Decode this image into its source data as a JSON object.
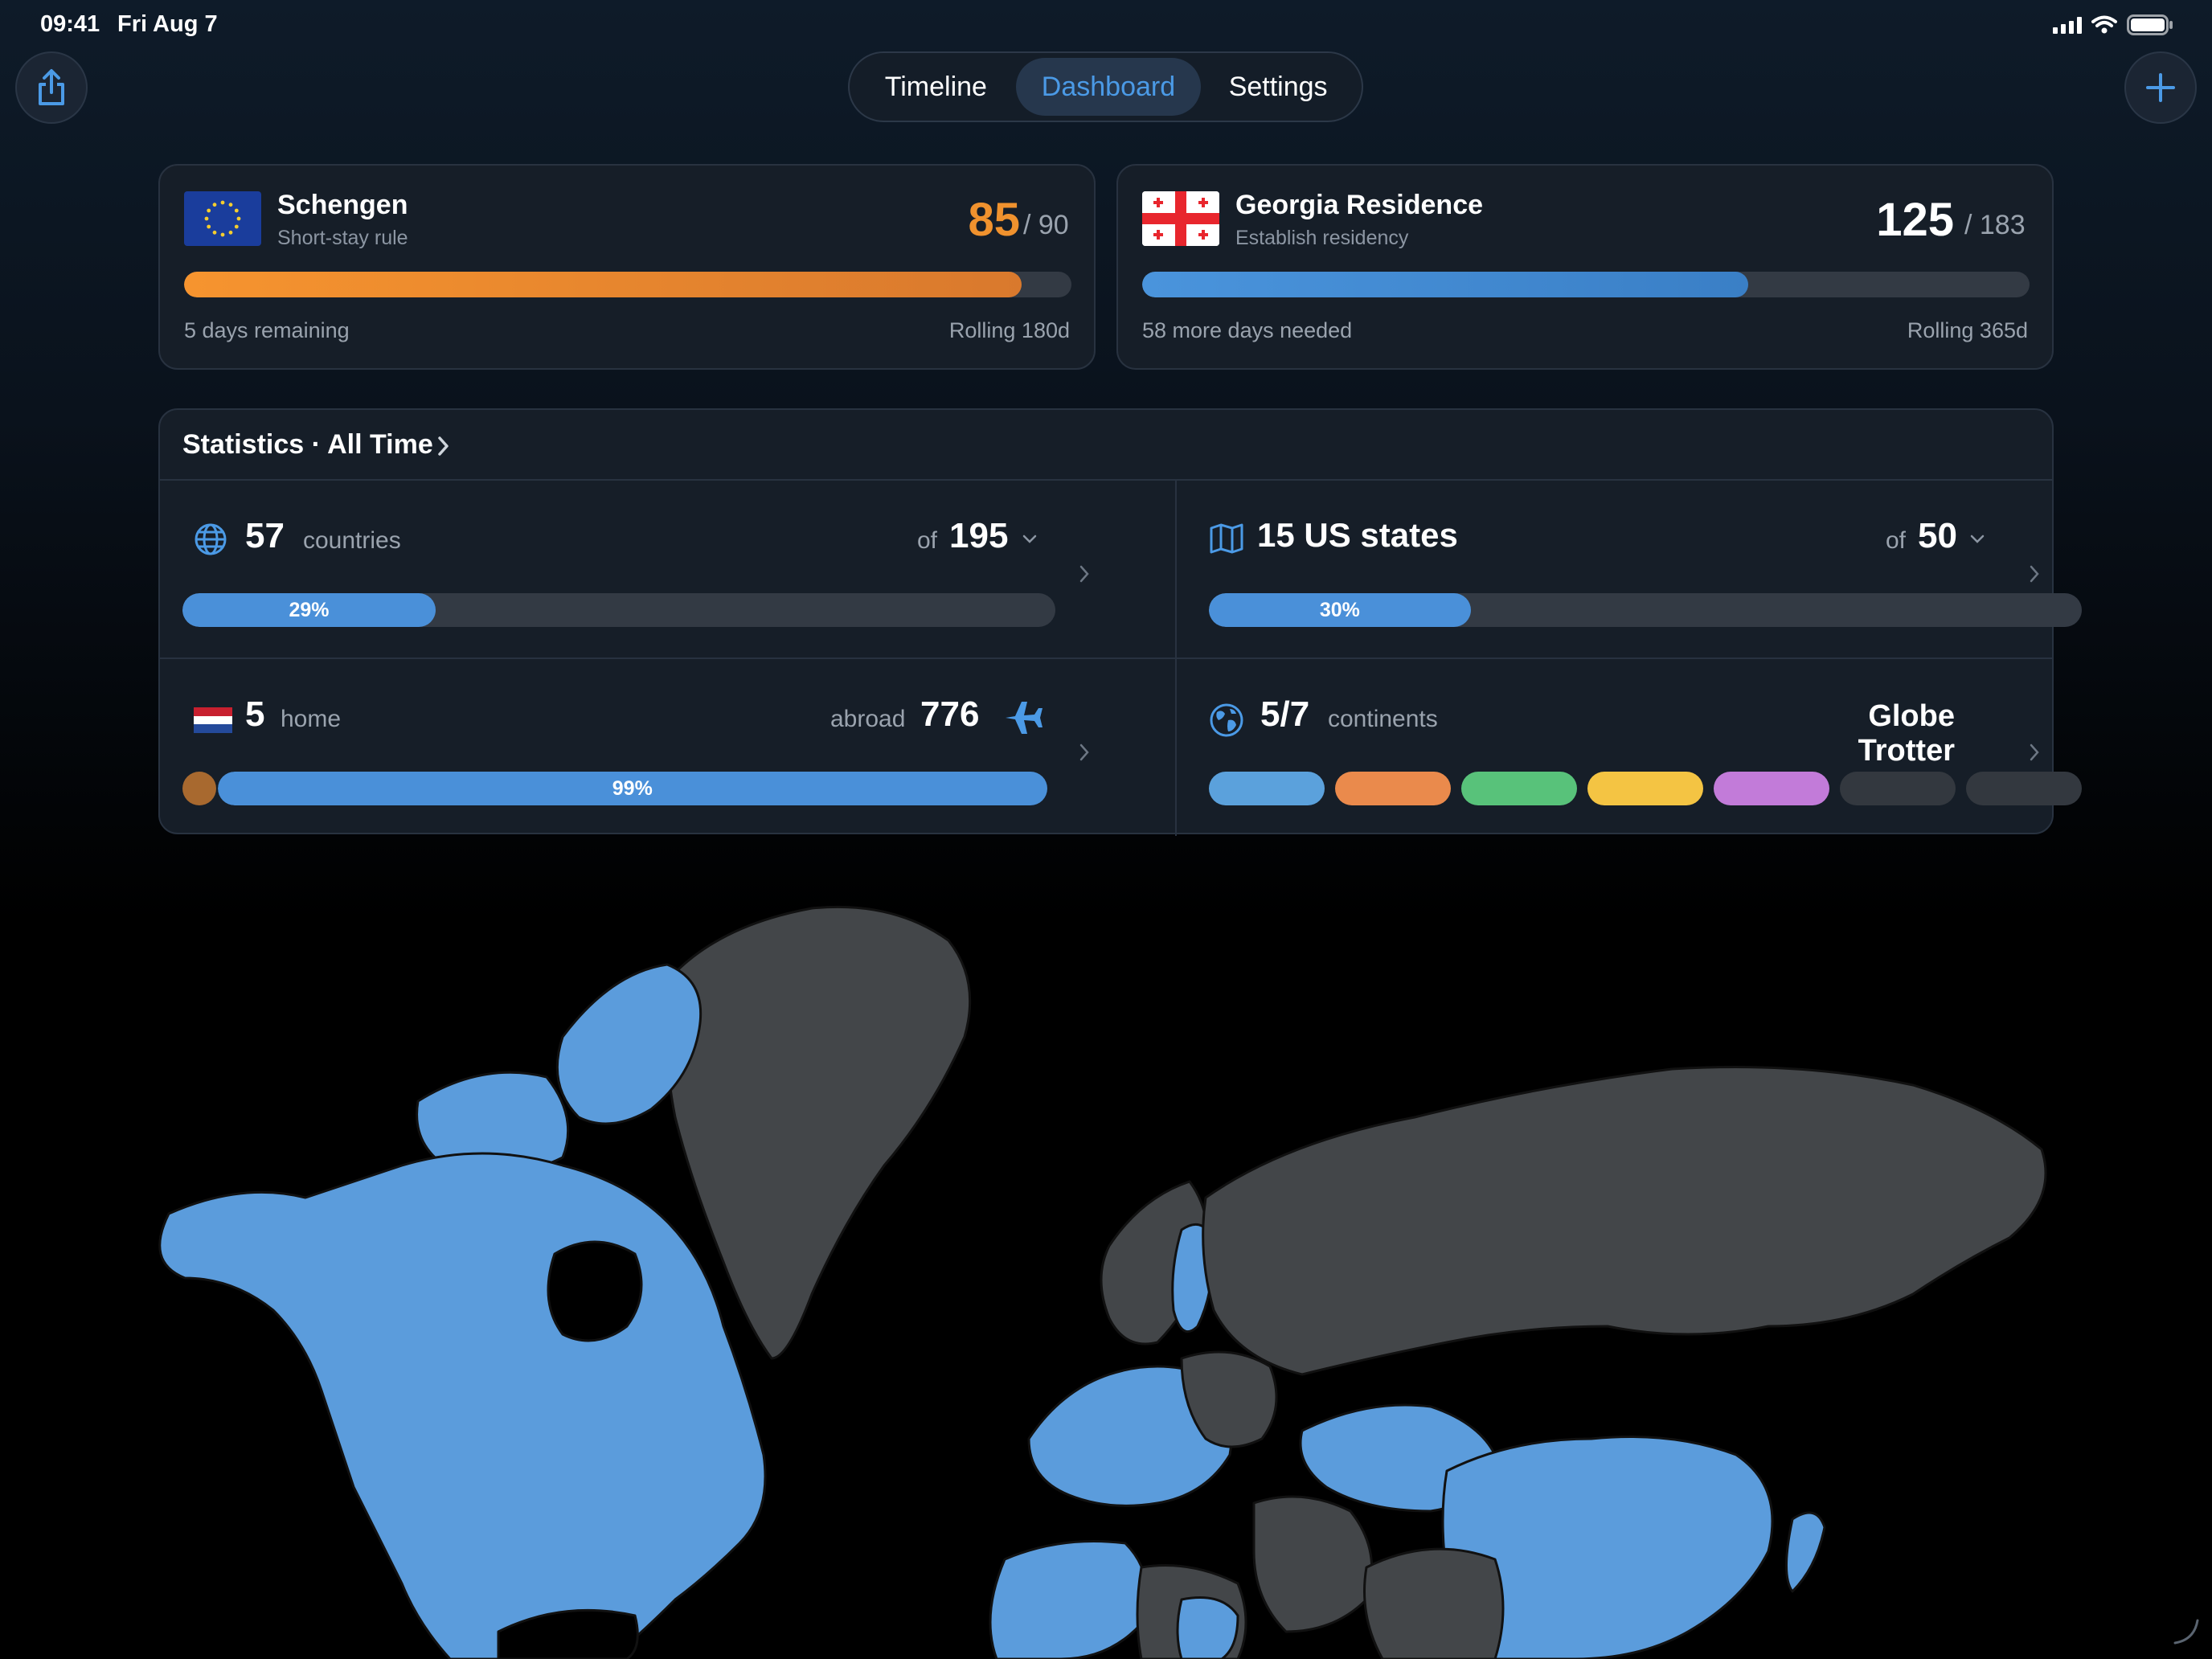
{
  "status": {
    "time": "09:41",
    "date": "Fri Aug 7"
  },
  "nav": {
    "share_icon": "share-icon",
    "add_icon": "plus-icon",
    "tabs": [
      {
        "label": "Timeline",
        "active": false
      },
      {
        "label": "Dashboard",
        "active": true
      },
      {
        "label": "Settings",
        "active": false
      }
    ]
  },
  "rules": [
    {
      "title": "Schengen",
      "subtitle": "Short-stay rule",
      "count": "85",
      "limit": "/ 90",
      "progress": 0.944,
      "color": "#f0922e",
      "footer_left": "5 days remaining",
      "footer_right": "Rolling 180d"
    },
    {
      "title": "Georgia Residence",
      "subtitle": "Establish residency",
      "count": "125",
      "limit": "/ 183",
      "progress": 0.683,
      "color": "#3f8bd6",
      "footer_left": "58 more days needed",
      "footer_right": "Rolling 365d"
    }
  ],
  "stats": {
    "title": "Statistics · All Time",
    "countries": {
      "value": "57",
      "label": "countries",
      "of": "of",
      "total": "195",
      "percent_label": "29%",
      "percent": 29
    },
    "us_states": {
      "value": "15 US states",
      "of": "of",
      "total": "50",
      "percent_label": "30%",
      "percent": 30
    },
    "home": {
      "value": "5",
      "label": "home",
      "abroad_label": "abroad",
      "abroad_value": "776",
      "percent_label": "99%",
      "percent": 99
    },
    "continents": {
      "value": "5/7",
      "label": "continents",
      "badge": "Globe Trotter",
      "colors": [
        "#5ba1dc",
        "#ea8a4c",
        "#58c27a",
        "#f4c443",
        "#c27bd9",
        "#33383f",
        "#33383f"
      ]
    }
  },
  "colors": {
    "visited": "#5b9cdc",
    "unvisited": "#434649",
    "accent": "#4b9ae6"
  }
}
